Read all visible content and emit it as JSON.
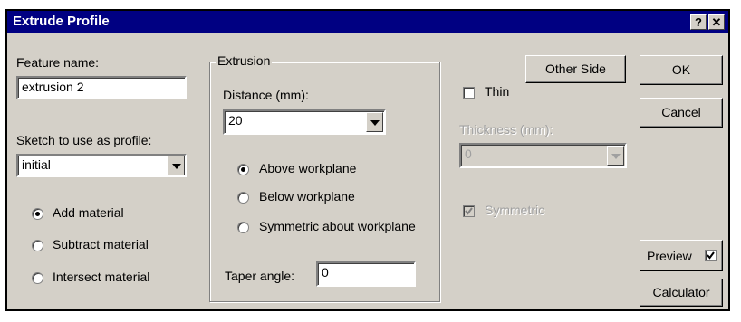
{
  "window": {
    "title": "Extrude Profile",
    "help_button": "?",
    "close_button": "✕"
  },
  "feature_name": {
    "label": "Feature name:",
    "value": "extrusion 2"
  },
  "sketch_profile": {
    "label": "Sketch to use as profile:",
    "value": "initial"
  },
  "operation": {
    "options": [
      {
        "label": "Add material",
        "selected": true
      },
      {
        "label": "Subtract material",
        "selected": false
      },
      {
        "label": "Intersect material",
        "selected": false
      }
    ]
  },
  "extrusion": {
    "group_label": "Extrusion",
    "distance_label": "Distance (mm):",
    "distance_value": "20",
    "direction_options": [
      {
        "label": "Above workplane",
        "selected": true
      },
      {
        "label": "Below workplane",
        "selected": false
      },
      {
        "label": "Symmetric about workplane",
        "selected": false
      }
    ],
    "taper_label": "Taper angle:",
    "taper_value": "0"
  },
  "thin": {
    "other_side_label": "Other Side",
    "thin_label": "Thin",
    "thin_checked": false,
    "thickness_label": "Thickness (mm):",
    "thickness_value": "0",
    "symmetric_label": "Symmetric",
    "symmetric_checked": true
  },
  "buttons": {
    "ok": "OK",
    "cancel": "Cancel",
    "preview": "Preview",
    "preview_checked": true,
    "calculator": "Calculator"
  },
  "colors": {
    "titlebar": "#000082",
    "dialog_face": "#d4d0c8",
    "disabled_text": "#a0a0a0"
  }
}
